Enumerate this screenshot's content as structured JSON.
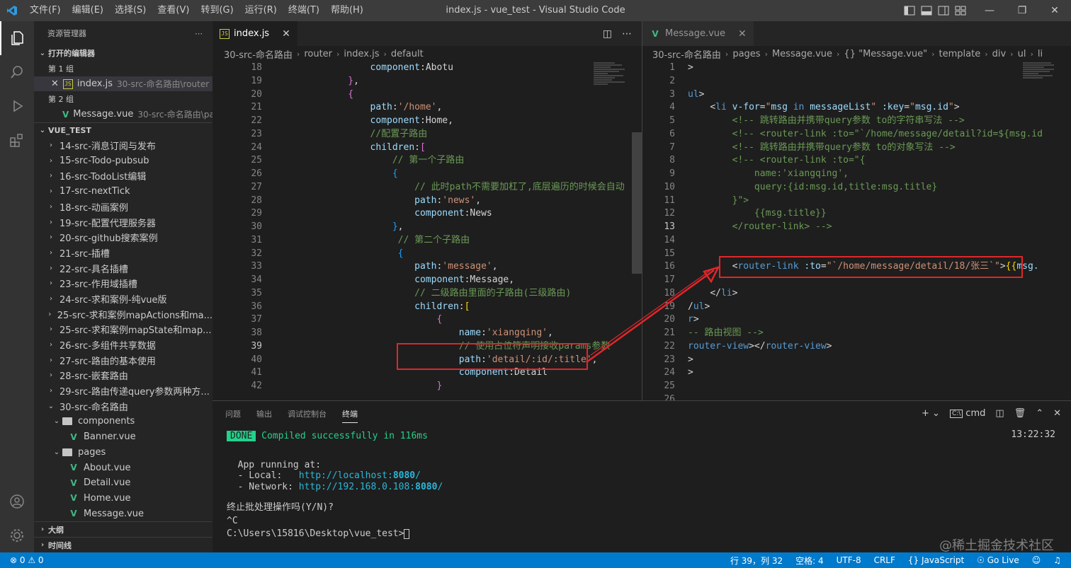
{
  "window": {
    "title": "index.js - vue_test - Visual Studio Code",
    "menu": [
      "文件(F)",
      "编辑(E)",
      "选择(S)",
      "查看(V)",
      "转到(G)",
      "运行(R)",
      "终端(T)",
      "帮助(H)"
    ]
  },
  "sidebar": {
    "title": "资源管理器",
    "open_editors": "打开的编辑器",
    "group1": "第 1 组",
    "group1_file": "index.js",
    "group1_path": "30-src-命名路由\\router",
    "group2": "第 2 组",
    "group2_file": "Message.vue",
    "group2_path": "30-src-命名路由\\pa...",
    "project": "VUE_TEST",
    "folders": [
      "14-src-消息订阅与发布",
      "15-src-Todo-pubsub",
      "16-src-TodoList编辑",
      "17-src-nextTick",
      "18-src-动画案例",
      "19-src-配置代理服务器",
      "20-src-github搜索案例",
      "21-src-插槽",
      "22-src-具名插槽",
      "23-src-作用域插槽",
      "24-src-求和案例-纯vue版",
      "25-src-求和案例mapActions和ma...",
      "25-src-求和案例mapState和map...",
      "26-src-多组件共享数据",
      "27-src-路由的基本使用",
      "28-src-嵌套路由",
      "29-src-路由传递query参数两种方..."
    ],
    "open_folder": "30-src-命名路由",
    "components": "components",
    "banner": "Banner.vue",
    "pages": "pages",
    "page_files": [
      "About.vue",
      "Detail.vue",
      "Home.vue",
      "Message.vue"
    ],
    "outline": "大纲",
    "timeline": "时间线"
  },
  "left_editor": {
    "tab": "index.js",
    "crumbs": [
      "30-src-命名路由",
      "router",
      "index.js",
      "default"
    ],
    "lines": [
      {
        "n": "18",
        "html": "                    <span class='a'>component</span><span class='p'>:Abotu</span>"
      },
      {
        "n": "19",
        "html": "                <span class='b2'>}</span><span class='p'>,</span>"
      },
      {
        "n": "20",
        "html": "                <span class='b2'>{</span>"
      },
      {
        "n": "21",
        "html": "                    <span class='a'>path</span><span class='p'>:</span><span class='s'>'/home'</span><span class='p'>,</span>"
      },
      {
        "n": "22",
        "html": "                    <span class='a'>component</span><span class='p'>:Home,</span>"
      },
      {
        "n": "23",
        "html": "                    <span class='c'>//配置子路由</span>"
      },
      {
        "n": "24",
        "html": "                    <span class='a'>children</span><span class='p'>:</span><span class='b2'>[</span>"
      },
      {
        "n": "25",
        "html": "                        <span class='c'>// 第一个子路由</span>"
      },
      {
        "n": "26",
        "html": "                        <span class='b3'>{</span>"
      },
      {
        "n": "27",
        "html": "                            <span class='c'>// 此时path不需要加杠了,底层遍历的时候会自动</span>"
      },
      {
        "n": "28",
        "html": "                            <span class='a'>path</span><span class='p'>:</span><span class='s'>'news'</span><span class='p'>,</span>"
      },
      {
        "n": "29",
        "html": "                            <span class='a'>component</span><span class='p'>:News</span>"
      },
      {
        "n": "30",
        "html": "                        <span class='b3'>}</span><span class='p'>,</span>"
      },
      {
        "n": "31",
        "html": "                         <span class='c'>// 第二个子路由</span>"
      },
      {
        "n": "32",
        "html": "                         <span class='b3'>{</span>"
      },
      {
        "n": "33",
        "html": "                            <span class='a'>path</span><span class='p'>:</span><span class='s'>'message'</span><span class='p'>,</span>"
      },
      {
        "n": "34",
        "html": "                            <span class='a'>component</span><span class='p'>:Message,</span>"
      },
      {
        "n": "35",
        "html": "                            <span class='c'>// 二级路由里面的子路由(三级路由)</span>"
      },
      {
        "n": "36",
        "html": "                            <span class='a'>children</span><span class='p'>:</span><span class='b1'>[</span>"
      },
      {
        "n": "37",
        "html": "                                <span class='b2'>{</span>"
      },
      {
        "n": "38",
        "html": "                                    <span class='a'>name</span><span class='p'>:</span><span class='s'>'xiangqing'</span><span class='p'>,</span>"
      },
      {
        "n": "39",
        "html": "                                    <span class='c'>// 使用占位符声明接收params参数</span>"
      },
      {
        "n": "40",
        "html": "                                    <span class='a'>path</span><span class='p'>:</span><span class='s'>'detail/:id/:title'</span><span class='p'>,</span>"
      },
      {
        "n": "41",
        "html": "                                    <span class='a'>component</span><span class='p'>:Detail</span>"
      },
      {
        "n": "42",
        "html": "                                <span class='b2'>}</span>"
      }
    ]
  },
  "right_editor": {
    "tab": "Message.vue",
    "crumbs": [
      "30-src-命名路由",
      "pages",
      "Message.vue",
      "{} \"Message.vue\"",
      "template",
      "div",
      "ul",
      "li"
    ],
    "lines": [
      {
        "n": "1",
        "html": "<span class='p'>&gt;</span>"
      },
      {
        "n": "2",
        "html": ""
      },
      {
        "n": "3",
        "html": "<span class='t'>ul</span><span class='p'>&gt;</span>"
      },
      {
        "n": "4",
        "html": "    <span class='p'>&lt;</span><span class='t'>li</span> <span class='a'>v-for</span><span class='p'>=</span><span class='s'>\"</span><span class='a'>msg</span> <span class='t'>in</span> <span class='a'>messageList</span><span class='s'>\"</span> <span class='a'>:key</span><span class='p'>=</span><span class='s'>\"</span><span class='a'>msg.id</span><span class='s'>\"</span><span class='p'>&gt;</span>"
      },
      {
        "n": "5",
        "html": "        <span class='c'>&lt;!-- 跳转路由并携带query参数 to的字符串写法 --&gt;</span>"
      },
      {
        "n": "6",
        "html": "        <span class='c'>&lt;!-- &lt;router-link :to=\"`/home/message/detail?id=${msg.id</span>"
      },
      {
        "n": "7",
        "html": "        <span class='c'>&lt;!-- 跳转路由并携带query参数 to的对象写法 --&gt;</span>"
      },
      {
        "n": "8",
        "html": "        <span class='c'>&lt;!-- &lt;router-link :to=\"{</span>"
      },
      {
        "n": "9",
        "html": "            <span class='c'>name:'xiangqing',</span>"
      },
      {
        "n": "10",
        "html": "            <span class='c'>query:{id:msg.id,title:msg.title}</span>"
      },
      {
        "n": "11",
        "html": "        <span class='c'>}\"&gt;</span>"
      },
      {
        "n": "12",
        "html": "            <span class='c'>{{msg.title}}</span>"
      },
      {
        "n": "13",
        "html": "        <span class='c'>&lt;/router-link&gt; --&gt;</span>"
      },
      {
        "n": "14",
        "html": ""
      },
      {
        "n": "15",
        "html": ""
      },
      {
        "n": "16",
        "html": "        <span class='p'>&lt;</span><span class='t'>router-link</span> <span class='a'>:to</span><span class='p'>=</span><span class='s'>\"`/home/message/detail/18/张三`\"</span><span class='p'>&gt;</span><span class='b1'>{{</span><span class='a'>msg.</span>"
      },
      {
        "n": "17",
        "html": ""
      },
      {
        "n": "18",
        "html": "    <span class='p'>&lt;/</span><span class='t'>li</span><span class='p'>&gt;</span>"
      },
      {
        "n": "19",
        "html": "<span class='p'>/</span><span class='t'>ul</span><span class='p'>&gt;</span>"
      },
      {
        "n": "20",
        "html": "<span class='t'>r</span><span class='p'>&gt;</span>"
      },
      {
        "n": "21",
        "html": "<span class='c'>-- 路由视图 --&gt;</span>"
      },
      {
        "n": "22",
        "html": "<span class='t'>router-view</span><span class='p'>&gt;&lt;/</span><span class='t'>router-view</span><span class='p'>&gt;</span>"
      },
      {
        "n": "23",
        "html": "<span class='p'>&gt;</span>"
      },
      {
        "n": "24",
        "html": "<span class='p'>&gt;</span>"
      },
      {
        "n": "25",
        "html": ""
      },
      {
        "n": "26",
        "html": ""
      }
    ]
  },
  "panel": {
    "tabs": [
      "问题",
      "输出",
      "调试控制台",
      "终端"
    ],
    "terminal_name": "cmd",
    "time": "13:22:32",
    "done": "DONE",
    "compiled": "Compiled successfully in 116ms",
    "app_running": "App running at:",
    "local_label": "- Local:   ",
    "local_url_a": "http://localhost:",
    "local_port": "8080",
    "local_url_b": "/",
    "network_label": "- Network: ",
    "network_url_a": "http://192.168.0.108:",
    "network_port": "8080",
    "network_url_b": "/",
    "prompt_stop": "终止批处理操作吗(Y/N)?",
    "ctrl_c": "^C",
    "cwd": "C:\\Users\\15816\\Desktop\\vue_test>"
  },
  "status": {
    "errors": "⊗ 0  ⚠ 0",
    "position": "行 39，列 32",
    "spaces": "空格: 4",
    "encoding": "UTF-8",
    "eol": "CRLF",
    "language": "{} JavaScript",
    "golive": "Go Live"
  },
  "watermark": "@稀土掘金技术社区"
}
